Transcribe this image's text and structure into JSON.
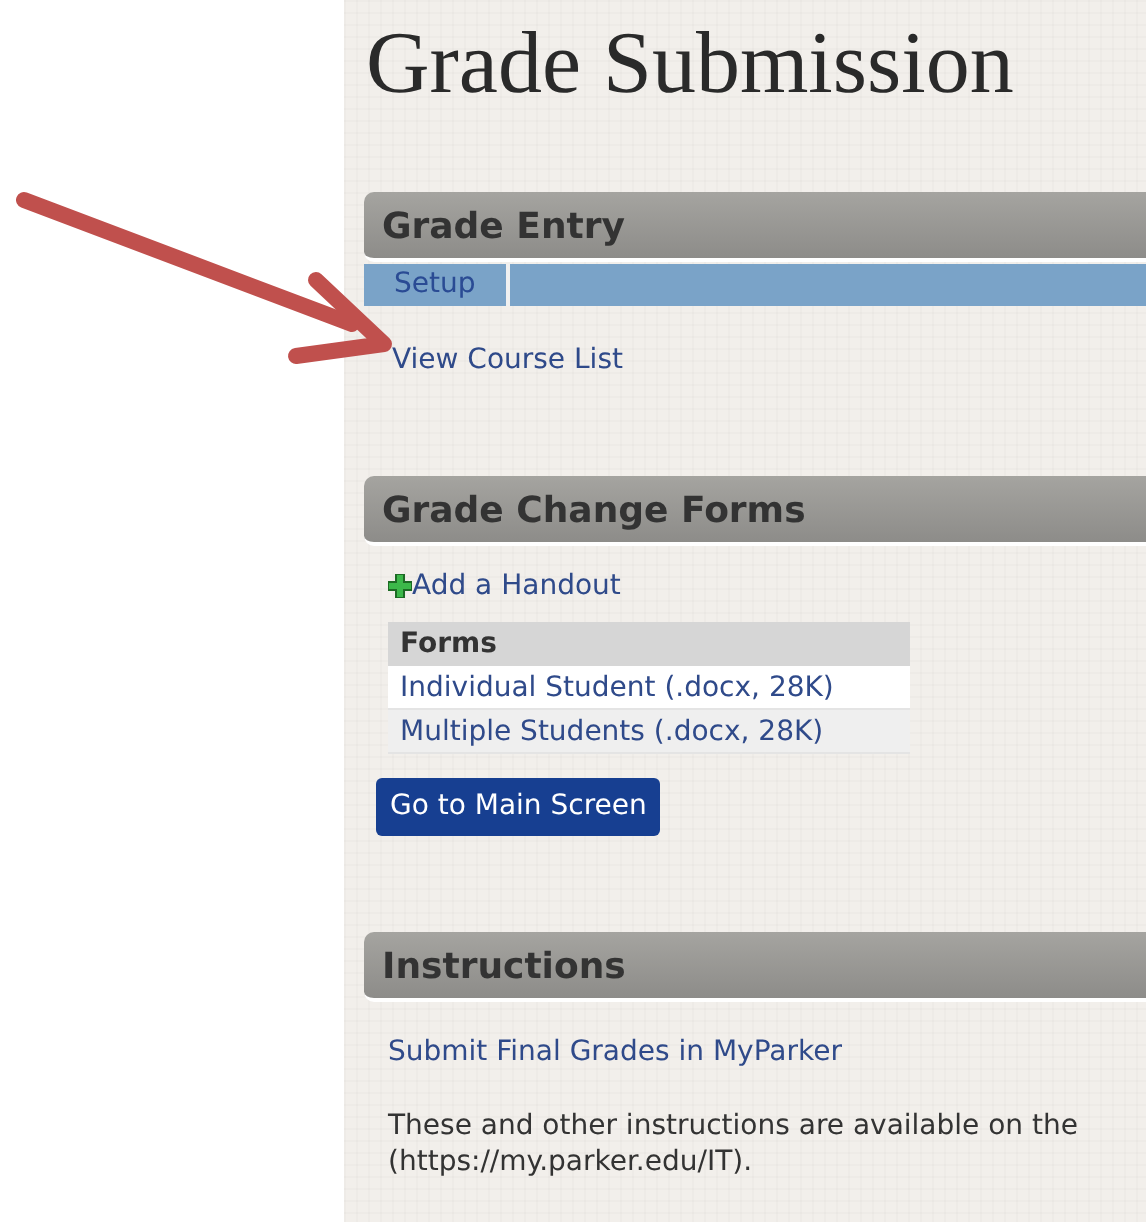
{
  "title": "Grade Submission",
  "sections": [
    {
      "kind": "tabs",
      "heading": "Grade Entry",
      "tabs": [
        {
          "label": "Setup"
        }
      ],
      "links": [
        "View Course List"
      ]
    },
    {
      "kind": "forms",
      "heading": "Grade Change Forms",
      "add_link": "Add a Handout",
      "table": {
        "columns": [
          "Forms"
        ],
        "rows": [
          [
            "Individual Student (.docx, 28K)"
          ],
          [
            "Multiple Students (.docx, 28K)"
          ]
        ]
      },
      "button": "Go to Main Screen"
    },
    {
      "kind": "text",
      "heading": "Instructions",
      "links": [
        "Submit Final Grades in MyParker"
      ],
      "paragraph": "These and other instructions are available on the\n(https://my.parker.edu/IT)."
    }
  ]
}
